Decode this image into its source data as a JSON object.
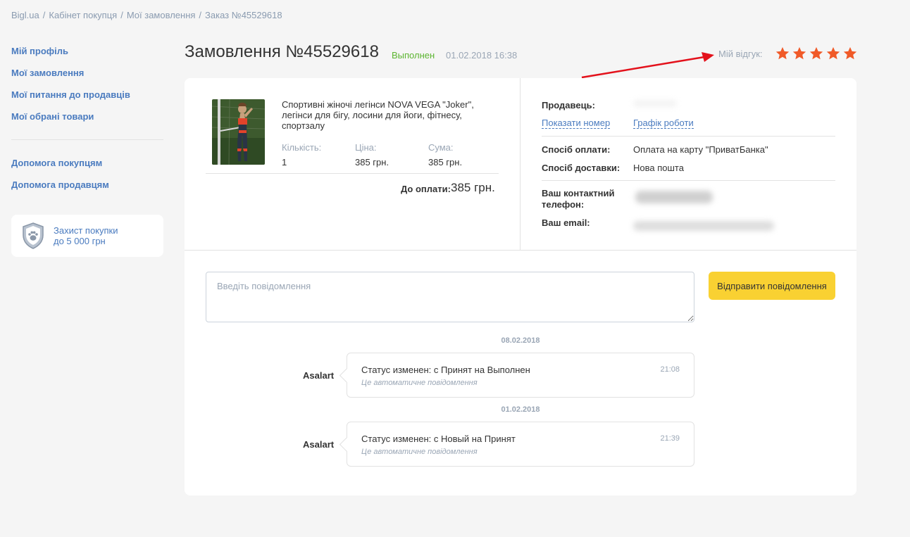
{
  "breadcrumb": [
    "Bigl.ua",
    "Кабінет покупця",
    "Мої замовлення",
    "Заказ №45529618"
  ],
  "breadcrumb_separator": "/",
  "sidebar": {
    "items": [
      "Мій профіль",
      "Мої замовлення",
      "Мої питання до продавців",
      "Мої обрані товари"
    ],
    "help_items": [
      "Допомога покупцям",
      "Допомога продавцям"
    ],
    "protection": {
      "line1": "Захист покупки",
      "line2": "до 5 000 грн",
      "icon": "shield-paw-icon"
    }
  },
  "order": {
    "title": "Замовлення №45529618",
    "status": "Выполнен",
    "status_color": "#5cb531",
    "datetime": "01.02.2018 16:38",
    "review_label": "Мій відгук:",
    "rating": 5,
    "rating_max": 5,
    "star_color": "#f05a28"
  },
  "product": {
    "name": "Спортивні жіночі легінси NOVA VEGA \"Joker\", легінси для бігу, лосини для йоги, фітнесу, спортзалу",
    "qty_label": "Кількість:",
    "qty": "1",
    "price_label": "Ціна:",
    "price": "385 грн.",
    "sum_label": "Сума:",
    "sum": "385 грн.",
    "total_label": "До оплати:",
    "total": "385 грн."
  },
  "seller": {
    "label": "Продавець:",
    "show_phone": "Показати номер",
    "schedule": "Графік роботи",
    "payment_label": "Спосіб оплати:",
    "payment": "Оплата на карту \"ПриватБанка\"",
    "delivery_label": "Спосіб доставки:",
    "delivery": "Нова пошта",
    "phone_label": "Ваш контактний телефон:",
    "email_label": "Ваш email:"
  },
  "message_form": {
    "placeholder": "Введіть повідомлення",
    "send_label": "Відправити повідомлення"
  },
  "messages": [
    {
      "date": "08.02.2018",
      "author": "Asalart",
      "text": "Статус изменен: с Принят на Выполнен",
      "time": "21:08",
      "note": "Це автоматичне повідомлення"
    },
    {
      "date": "01.02.2018",
      "author": "Asalart",
      "text": "Статус изменен: с Новый на Принят",
      "time": "21:39",
      "note": "Це автоматичне повідомлення"
    }
  ],
  "colors": {
    "accent": "#4a7bbf",
    "button": "#f9d132",
    "arrow": "#e3111b"
  }
}
